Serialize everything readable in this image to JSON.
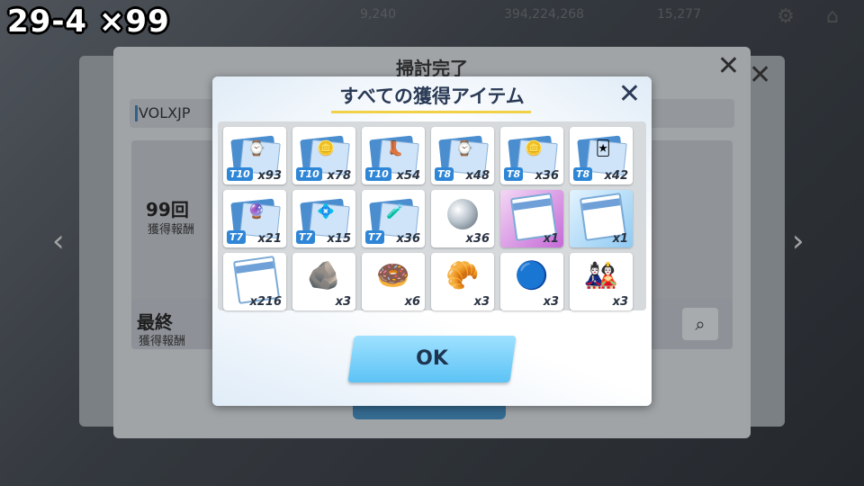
{
  "overlay_label": "29-4 ×99",
  "topbar": {
    "stat1": "9,240",
    "stat2": "394,224,268",
    "stat3": "15,277"
  },
  "background_dialog": {
    "title": "掃討完了",
    "player_name": "VOLXJP",
    "count_label": "99回",
    "count_sub": "獲得報酬",
    "final_label": "最終",
    "final_sub": "獲得報酬"
  },
  "dialog": {
    "title": "すべての獲得アイテム",
    "ok_label": "OK"
  },
  "items": [
    {
      "tier": "T10",
      "qty": "x93",
      "icon": "dark-gadget",
      "glyph": "⌚"
    },
    {
      "tier": "T10",
      "qty": "x78",
      "icon": "gold-coin",
      "glyph": "🪙"
    },
    {
      "tier": "T10",
      "qty": "x54",
      "icon": "dark-boots",
      "glyph": "👢"
    },
    {
      "tier": "T8",
      "qty": "x48",
      "icon": "watch",
      "glyph": "⌚"
    },
    {
      "tier": "T8",
      "qty": "x36",
      "icon": "brown-coin",
      "glyph": "🪙"
    },
    {
      "tier": "T8",
      "qty": "x42",
      "icon": "paper-cards",
      "glyph": "🃏"
    },
    {
      "tier": "T7",
      "qty": "x21",
      "icon": "purple-charm",
      "glyph": "🔮"
    },
    {
      "tier": "T7",
      "qty": "x15",
      "icon": "pink-badge",
      "glyph": "💠"
    },
    {
      "tier": "T7",
      "qty": "x36",
      "icon": "purple-bracer",
      "glyph": "🧪"
    },
    {
      "tier": "",
      "qty": "x36",
      "icon": "silver-orb",
      "glyph": ""
    },
    {
      "tier": "",
      "qty": "x1",
      "icon": "purple-report",
      "glyph": ""
    },
    {
      "tier": "",
      "qty": "x1",
      "icon": "blue-report",
      "glyph": ""
    },
    {
      "tier": "",
      "qty": "x216",
      "icon": "white-report",
      "glyph": ""
    },
    {
      "tier": "",
      "qty": "x3",
      "icon": "black-stone",
      "glyph": "🪨"
    },
    {
      "tier": "",
      "qty": "x6",
      "icon": "ring-artifact",
      "glyph": "🍩"
    },
    {
      "tier": "",
      "qty": "x3",
      "icon": "golden-croissant",
      "glyph": "🥐"
    },
    {
      "tier": "",
      "qty": "x3",
      "icon": "crystal-ball",
      "glyph": "🔵"
    },
    {
      "tier": "",
      "qty": "x3",
      "icon": "doll-figure",
      "glyph": "🎎"
    }
  ]
}
